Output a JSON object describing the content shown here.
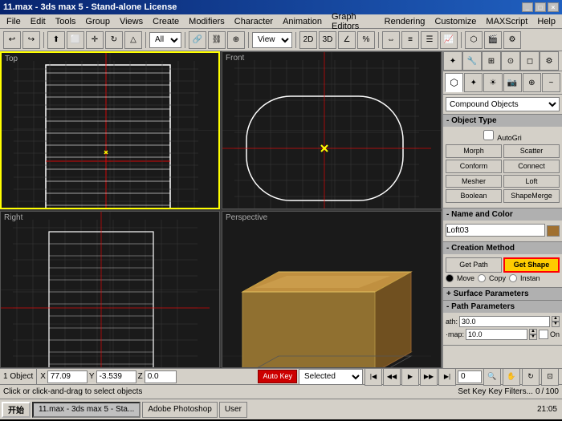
{
  "title": "11.max - 3ds max 5 - Stand-alone License",
  "titlebar_buttons": [
    "_",
    "□",
    "×"
  ],
  "menu": {
    "items": [
      "File",
      "Edit",
      "Tools",
      "Group",
      "Views",
      "Create",
      "Modifiers",
      "Character",
      "Animation",
      "Graph Editors",
      "Rendering",
      "Customize",
      "MAXScript",
      "Help"
    ]
  },
  "toolbar": {
    "all_dropdown": "All",
    "view_dropdown": "View"
  },
  "viewports": {
    "top": {
      "label": "Top"
    },
    "front": {
      "label": "Front"
    },
    "right": {
      "label": "Right"
    },
    "perspective": {
      "label": "Perspective"
    }
  },
  "right_panel": {
    "dropdown": "Compound Objects",
    "object_type_header": "- Object Type",
    "autogrid_label": "AutoGri",
    "buttons": {
      "morph": "Morph",
      "scatter": "Scatter",
      "conform": "Conform",
      "connect": "Connect",
      "mesher": "Mesher",
      "loft": "Loft",
      "boolean": "Boolean",
      "shapemerge": "ShapeMerge"
    },
    "name_color_header": "- Name and Color",
    "name_value": "Loft03",
    "color_hex": "#a07030",
    "creation_method_header": "- Creation Method",
    "get_path": "Get Path",
    "get_shape": "Get Shape",
    "move": "Move",
    "copy": "Copy",
    "instance": "Instan",
    "surface_params_header": "+ Surface Parameters",
    "path_params_header": "- Path Parameters",
    "path_label": "ath:",
    "path_value": "30.0",
    "snap_label": "·map:",
    "snap_value": "10.0",
    "on_label": "On",
    "on_checked": false
  },
  "status_bar": {
    "object_count": "1 Object",
    "x_label": "X",
    "x_value": "77.09",
    "y_label": "Y",
    "y_value": "-3.539",
    "z_label": "Z",
    "z_value": "0.0",
    "autokey": "Auto Key",
    "selected": "Selected",
    "set_key": "Set Key",
    "key_filters": "Key Filters..."
  },
  "bottom_status": {
    "message": "Click or click-and-drag to select objects",
    "frame_current": "0",
    "frame_total": "100"
  },
  "taskbar": {
    "start": "开始",
    "items": [
      "11.max - 3ds max 5 - Sta...",
      "Adobe Photoshop",
      "User"
    ],
    "clock": "21:05"
  },
  "red_arrow_svg": true
}
